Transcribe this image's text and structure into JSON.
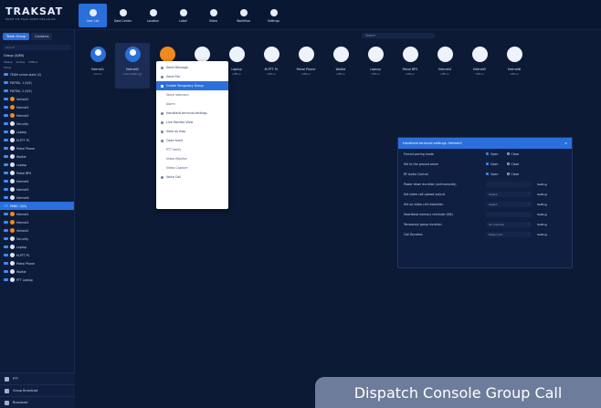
{
  "app": {
    "brand": "TRAKSAT",
    "tagline": "PUSH TO TALK OVER CELLULAR"
  },
  "nav": [
    {
      "label": "User List",
      "icon": "user-icon",
      "active": true
    },
    {
      "label": "Data Center",
      "icon": "database-icon",
      "active": false
    },
    {
      "label": "Location",
      "icon": "location-pin-icon",
      "active": false
    },
    {
      "label": "Label",
      "icon": "label-icon",
      "active": false
    },
    {
      "label": "Video",
      "icon": "video-icon",
      "active": false
    },
    {
      "label": "Workflow",
      "icon": "workflow-icon",
      "active": false
    },
    {
      "label": "Settings",
      "icon": "gear-icon",
      "active": false
    }
  ],
  "left_panel": {
    "tabs": [
      {
        "label": "Team Group",
        "active": true
      },
      {
        "label": "Contacts",
        "active": false
      }
    ],
    "search_placeholder": "Search",
    "group_title": "Group (5/85)",
    "filters": [
      "Status",
      "Online",
      "Offline"
    ],
    "filter_caption": "Show",
    "rows": [
      {
        "label": "TEAM online state (2)",
        "kind": "chk",
        "hl": false
      },
      {
        "label": "PATROL 1 (0/5)",
        "kind": "chk",
        "hl": false
      },
      {
        "label": "PATROL 2 (0/5)",
        "kind": "chk",
        "hl": false
      },
      {
        "label": "Vehicle2",
        "kind": "orange",
        "hl": false
      },
      {
        "label": "Helmet1",
        "kind": "orange",
        "hl": false
      },
      {
        "label": "Helmet2",
        "kind": "orange",
        "hl": false
      },
      {
        "label": "Security",
        "kind": "dot",
        "hl": false
      },
      {
        "label": "Laptop",
        "kind": "dot",
        "hl": false
      },
      {
        "label": "M-PTT PL",
        "kind": "dot",
        "hl": false
      },
      {
        "label": "Patrol Phone",
        "kind": "dot",
        "hl": false
      },
      {
        "label": "Walkie",
        "kind": "dot",
        "hl": false
      },
      {
        "label": "Laptop",
        "kind": "dot",
        "hl": false
      },
      {
        "label": "Patrol BPS",
        "kind": "dot",
        "hl": false
      },
      {
        "label": "Helmet4",
        "kind": "dot",
        "hl": false
      },
      {
        "label": "Helmet5",
        "kind": "dot",
        "hl": false
      },
      {
        "label": "Helmet6",
        "kind": "dot",
        "hl": false
      },
      {
        "label": "PANIC (0/5)",
        "kind": "chk",
        "hl": true
      },
      {
        "label": "Helmet1",
        "kind": "orange",
        "hl": false
      },
      {
        "label": "Helmet2",
        "kind": "orange",
        "hl": false
      },
      {
        "label": "Vehicle2",
        "kind": "orange",
        "hl": false
      },
      {
        "label": "Security",
        "kind": "dot",
        "hl": false
      },
      {
        "label": "Laptop",
        "kind": "dot",
        "hl": false
      },
      {
        "label": "M-PTT PL",
        "kind": "dot",
        "hl": false
      },
      {
        "label": "Patrol Phone",
        "kind": "dot",
        "hl": false
      },
      {
        "label": "Walkie",
        "kind": "dot",
        "hl": false
      },
      {
        "label": "PTT Laptop",
        "kind": "dot",
        "hl": false
      }
    ],
    "bottom_items": [
      {
        "label": "PTT",
        "icon": "ptt-icon"
      },
      {
        "label": "Group Broadcast",
        "icon": "broadcast-icon"
      },
      {
        "label": "Broadcast",
        "icon": "megaphone-icon"
      }
    ]
  },
  "main": {
    "search_placeholder": "Search",
    "users": [
      {
        "name": "Helmet1",
        "status": "Online",
        "avatar": "blue",
        "selected": false
      },
      {
        "name": "Helmet2",
        "status": "Online(Talking)",
        "avatar": "blue",
        "selected": true
      },
      {
        "name": "Vehicle2",
        "status": "Online",
        "avatar": "orange",
        "selected": false
      },
      {
        "name": "Security",
        "status": "Offline",
        "avatar": "white",
        "selected": false
      },
      {
        "name": "Laptop",
        "status": "Offline",
        "avatar": "white",
        "selected": false
      },
      {
        "name": "M-PTT PL",
        "status": "Offline",
        "avatar": "white",
        "selected": false
      },
      {
        "name": "Patrol Phone",
        "status": "Offline",
        "avatar": "white",
        "selected": false
      },
      {
        "name": "Walkie",
        "status": "Offline",
        "avatar": "white",
        "selected": false
      },
      {
        "name": "Laptop",
        "status": "Offline",
        "avatar": "white",
        "selected": false
      },
      {
        "name": "Patrol BPS",
        "status": "Offline",
        "avatar": "white",
        "selected": false
      },
      {
        "name": "Helmet4",
        "status": "Offline",
        "avatar": "white",
        "selected": false
      },
      {
        "name": "Helmet5",
        "status": "Offline",
        "avatar": "white",
        "selected": false
      },
      {
        "name": "Helmet6",
        "status": "Offline",
        "avatar": "white",
        "selected": false
      }
    ],
    "context_menu": [
      {
        "label": "Send Message",
        "hl": false,
        "sub": false
      },
      {
        "label": "Send File",
        "hl": false,
        "sub": false
      },
      {
        "label": "Create Temporary Group",
        "hl": true,
        "sub": false
      },
      {
        "label": "Voice Intercom",
        "hl": false,
        "sub": true
      },
      {
        "label": "Alarm",
        "hl": false,
        "sub": true
      },
      {
        "label": "Handheld terminal settings",
        "hl": false,
        "sub": false
      },
      {
        "label": "Live Monitor View",
        "hl": false,
        "sub": false
      },
      {
        "label": "View on map",
        "hl": false,
        "sub": false
      },
      {
        "label": "Open track",
        "hl": false,
        "sub": false
      },
      {
        "label": "PTT Verify",
        "hl": false,
        "sub": true
      },
      {
        "label": "Video Monitor",
        "hl": false,
        "sub": true
      },
      {
        "label": "Video Capture",
        "hl": false,
        "sub": true
      },
      {
        "label": "Voice Call",
        "hl": false,
        "sub": false
      }
    ],
    "settings_dialog": {
      "title": "Handheld terminal settings: Helmet2",
      "close": "×",
      "rows": [
        {
          "label": "Forced pairing mode",
          "type": "radio",
          "options": [
            "Open",
            "Close"
          ],
          "on": 0
        },
        {
          "label": "Fall to the ground alarm",
          "type": "radio",
          "options": [
            "Open",
            "Close"
          ],
          "on": 0
        },
        {
          "label": "RF Audio Control",
          "type": "radio",
          "options": [
            "Open",
            "Close"
          ],
          "on": 0
        },
        {
          "label": "Power down duration (unit:seconds)",
          "type": "field",
          "value": "",
          "button": "Setting"
        },
        {
          "label": "Set video call upload output",
          "type": "field",
          "value": "Select",
          "button": "Setting"
        },
        {
          "label": "Set up video call resolution",
          "type": "field",
          "value": "Select",
          "button": "Setting"
        },
        {
          "label": "Heartbeat memory reminder (KB)",
          "type": "field",
          "value": "",
          "button": "Setting"
        },
        {
          "label": "Temporary group duration",
          "type": "field",
          "value": "10 minutes",
          "button": "Setting"
        },
        {
          "label": "Call Duration",
          "type": "field",
          "value": "60second",
          "button": "Setting"
        }
      ]
    }
  },
  "caption": "Dispatch Console Group Call"
}
